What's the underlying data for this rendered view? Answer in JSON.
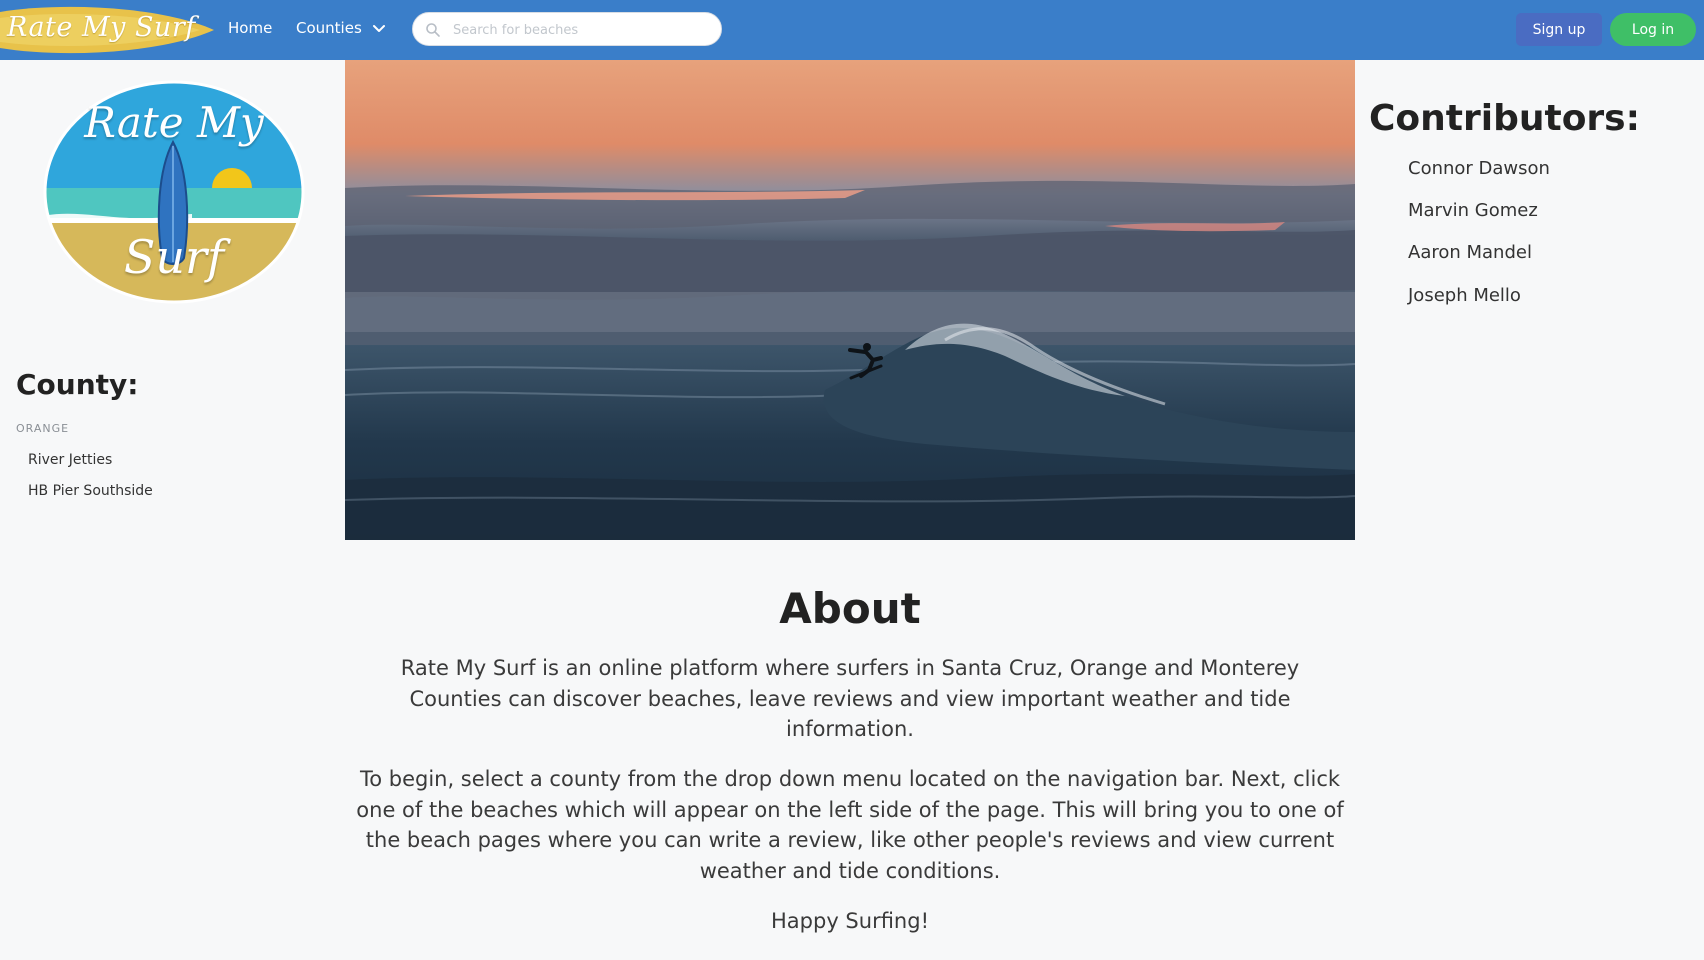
{
  "navbar": {
    "brand": "Rate My Surf",
    "home_label": "Home",
    "counties_label": "Counties",
    "search_placeholder": "Search for beaches",
    "signup_label": "Sign up",
    "login_label": "Log in",
    "icons": {
      "search": "search-icon",
      "counties_toggle": "chevron-down-icon"
    }
  },
  "logo": {
    "line1": "Rate My",
    "line2": "Surf"
  },
  "sidebar": {
    "title": "County:",
    "county": "ORANGE",
    "beaches": [
      {
        "label": "River Jetties"
      },
      {
        "label": "HB Pier Southside"
      }
    ]
  },
  "contributors": {
    "title": "Contributors:",
    "names": [
      "Connor Dawson",
      "Marvin Gomez",
      "Aaron Mandel",
      "Joseph Mello"
    ]
  },
  "about": {
    "title": "About",
    "paragraphs": [
      "Rate My Surf is an online platform where surfers in Santa Cruz, Orange and Monterey Counties can discover beaches, leave reviews and view important weather and tide information.",
      "To begin, select a county from the drop down menu located on the navigation bar. Next, click one of the beaches which will appear on the left side of the page. This will bring you to one of the beach pages where you can write a review, like other people's reviews and view current weather and tide conditions.",
      "Happy Surfing!"
    ]
  },
  "colors": {
    "navbar": "#3a7ec9",
    "signup": "#4a6cc2",
    "login": "#3fbf67",
    "background": "#f7f8f9"
  }
}
